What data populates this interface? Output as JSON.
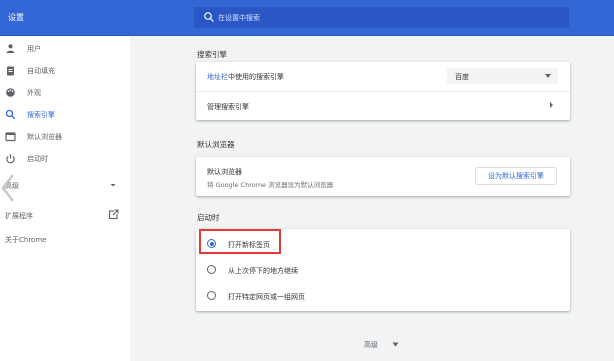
{
  "header": {
    "title": "设置",
    "search_placeholder": "在设置中搜索"
  },
  "sidebar": {
    "items": [
      {
        "label": "用户",
        "icon": "person-icon"
      },
      {
        "label": "自动填充",
        "icon": "clipboard-icon"
      },
      {
        "label": "外观",
        "icon": "palette-icon"
      },
      {
        "label": "搜索引擎",
        "icon": "search-icon",
        "active": true
      },
      {
        "label": "默认浏览器",
        "icon": "browser-window-icon"
      },
      {
        "label": "启动时",
        "icon": "power-icon"
      }
    ],
    "advanced_label": "高级",
    "extensions_label": "扩展程序",
    "about_label": "关于Chrome"
  },
  "search_engine": {
    "section_title": "搜索引擎",
    "row1_link": "地址栏",
    "row1_text": "中使用的搜索引擎",
    "selected_engine": "百度",
    "manage_label": "管理搜索引擎"
  },
  "default_browser": {
    "section_title": "默认浏览器",
    "title": "默认浏览器",
    "subtitle": "将 Google Chrome 浏览器设为默认浏览器",
    "button_label": "设为默认搜索引擎"
  },
  "startup": {
    "section_title": "启动时",
    "options": [
      {
        "label": "打开新标签页",
        "selected": true
      },
      {
        "label": "从上次停下的地方继续",
        "selected": false
      },
      {
        "label": "打开特定网页或一组网页",
        "selected": false
      }
    ]
  },
  "footer": {
    "advanced_label": "高级"
  },
  "colors": {
    "accent": "#3367d6",
    "highlight_box": "#e53935"
  }
}
